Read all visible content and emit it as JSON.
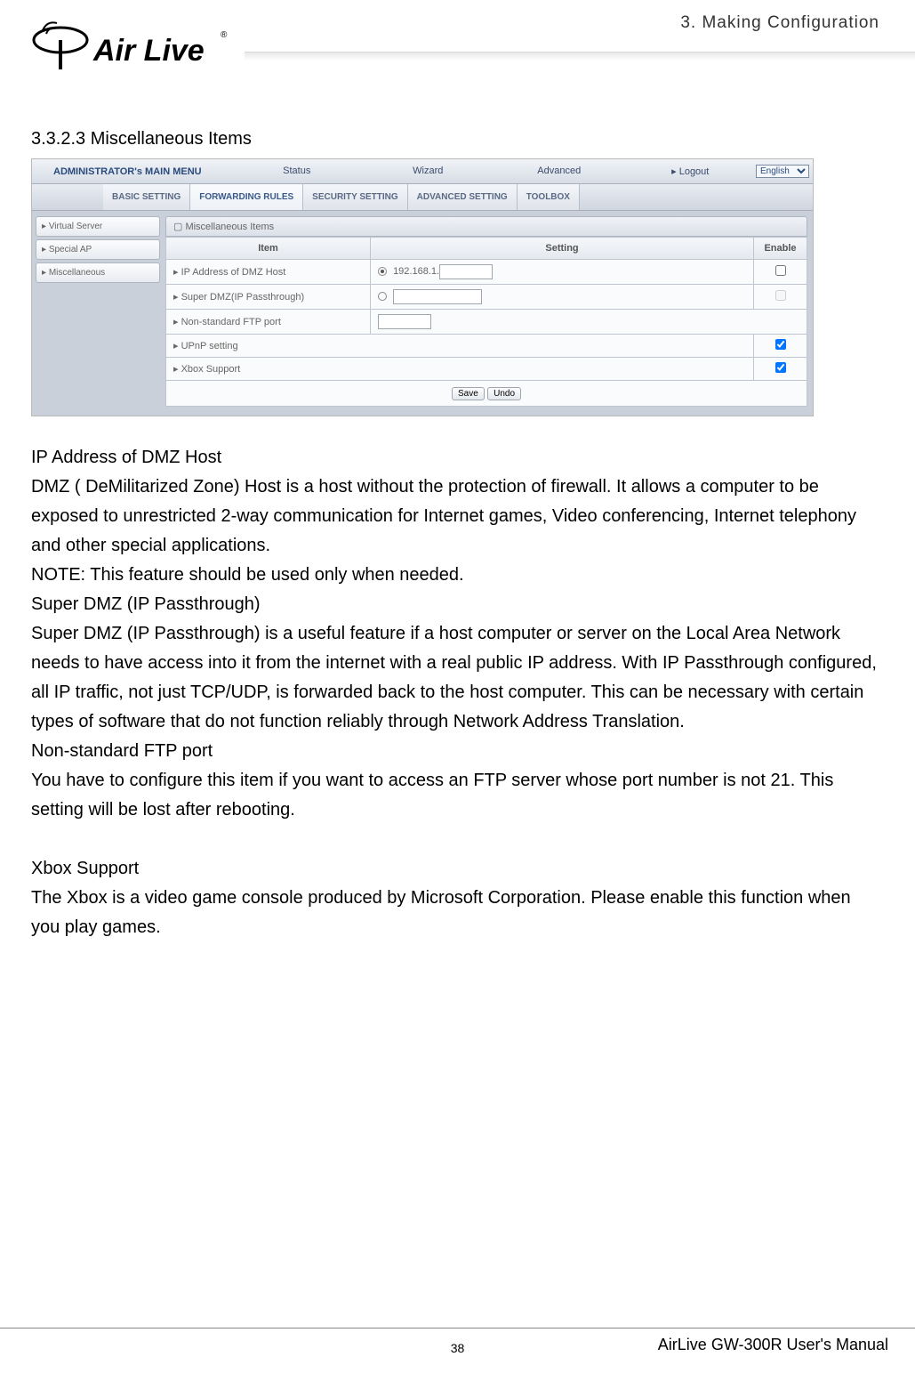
{
  "chapter_title": "3.  Making  Configuration",
  "logo_text": "Air Live",
  "section_heading": "3.3.2.3 Miscellaneous Items",
  "screenshot": {
    "top_menu": {
      "title": "ADMINISTRATOR's MAIN MENU",
      "items": [
        "Status",
        "Wizard",
        "Advanced",
        "Logout"
      ],
      "lang": "English"
    },
    "sub_tabs": [
      "BASIC SETTING",
      "FORWARDING RULES",
      "SECURITY SETTING",
      "ADVANCED SETTING",
      "TOOLBOX"
    ],
    "sidebar": [
      "Virtual Server",
      "Special AP",
      "Miscellaneous"
    ],
    "panel_title": "Miscellaneous Items",
    "table": {
      "headers": {
        "item": "Item",
        "setting": "Setting",
        "enable": "Enable"
      },
      "rows": [
        {
          "item": "IP Address of DMZ Host",
          "setting_prefix": "192.168.1.",
          "radio_selected": true,
          "has_enable": true,
          "enable_checked": false
        },
        {
          "item": "Super DMZ(IP Passthrough)",
          "setting_prefix": "",
          "radio_selected": false,
          "has_enable": true,
          "enable_checked": false,
          "enable_disabled": true
        },
        {
          "item": "Non-standard FTP port",
          "setting_prefix": "",
          "no_radio": true,
          "has_enable": false
        },
        {
          "item": "UPnP setting",
          "no_setting": true,
          "has_enable": true,
          "enable_checked": true
        },
        {
          "item": "Xbox Support",
          "no_setting": true,
          "has_enable": true,
          "enable_checked": true
        }
      ]
    },
    "buttons": {
      "save": "Save",
      "undo": "Undo"
    }
  },
  "doc": {
    "h1": "IP Address of DMZ Host",
    "p1": "DMZ ( DeMilitarized Zone) Host is a host without the protection of firewall. It allows a computer to be exposed to unrestricted 2-way communication for Internet games, Video conferencing, Internet telephony and other special applications.",
    "note": "NOTE: This feature should be used only when needed.",
    "h2": "Super DMZ (IP Passthrough)",
    "p2": "Super DMZ (IP Passthrough) is a useful feature if a host computer or server on the Local Area Network needs to have access into it from the internet with a real public IP address. With IP Passthrough configured, all IP traffic, not just TCP/UDP, is forwarded back to the host computer. This can be necessary with certain types of software that do not function reliably through Network Address Translation.",
    "h3": "Non-standard FTP port",
    "p3": "You have to configure this item if you want to access an FTP server whose port number is not 21. This setting will be lost after rebooting.",
    "h4": "Xbox Support",
    "p4": "The Xbox is a video game console produced by Microsoft Corporation. Please enable this function when you play games."
  },
  "footer": {
    "page": "38",
    "manual": "AirLive GW-300R User's Manual"
  }
}
